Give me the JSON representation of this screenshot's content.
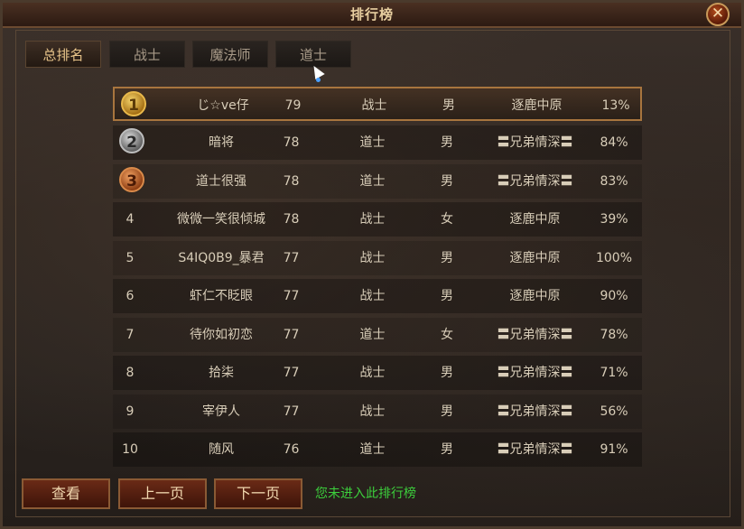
{
  "window": {
    "title": "排行榜",
    "close_label": "✕"
  },
  "tabs": [
    {
      "label": "总排名",
      "active": true
    },
    {
      "label": "战士",
      "active": false
    },
    {
      "label": "魔法师",
      "active": false
    },
    {
      "label": "道士",
      "active": false
    }
  ],
  "rows": [
    {
      "rank": "1",
      "name": "じ☆ve仔",
      "level": "79",
      "class": "战士",
      "gender": "男",
      "guild": "逐鹿中原",
      "pct": "13%"
    },
    {
      "rank": "2",
      "name": "暗将",
      "level": "78",
      "class": "道士",
      "gender": "男",
      "guild": "〓兄弟情深〓",
      "pct": "84%"
    },
    {
      "rank": "3",
      "name": "道士很强",
      "level": "78",
      "class": "道士",
      "gender": "男",
      "guild": "〓兄弟情深〓",
      "pct": "83%"
    },
    {
      "rank": "4",
      "name": "微微一笑很倾城",
      "level": "78",
      "class": "战士",
      "gender": "女",
      "guild": "逐鹿中原",
      "pct": "39%"
    },
    {
      "rank": "5",
      "name": "S4IQ0B9_暴君",
      "level": "77",
      "class": "战士",
      "gender": "男",
      "guild": "逐鹿中原",
      "pct": "100%"
    },
    {
      "rank": "6",
      "name": "虾仁不眨眼",
      "level": "77",
      "class": "战士",
      "gender": "男",
      "guild": "逐鹿中原",
      "pct": "90%"
    },
    {
      "rank": "7",
      "name": "待你如初恋",
      "level": "77",
      "class": "道士",
      "gender": "女",
      "guild": "〓兄弟情深〓",
      "pct": "78%"
    },
    {
      "rank": "8",
      "name": "拾柒",
      "level": "77",
      "class": "战士",
      "gender": "男",
      "guild": "〓兄弟情深〓",
      "pct": "71%"
    },
    {
      "rank": "9",
      "name": "宰伊人",
      "level": "77",
      "class": "战士",
      "gender": "男",
      "guild": "〓兄弟情深〓",
      "pct": "56%"
    },
    {
      "rank": "10",
      "name": "随风",
      "level": "76",
      "class": "道士",
      "gender": "男",
      "guild": "〓兄弟情深〓",
      "pct": "91%"
    }
  ],
  "buttons": {
    "view": "查看",
    "prev": "上一页",
    "next": "下一页"
  },
  "status": "您未进入此排行榜",
  "colors": {
    "status_green": "#3ccf3c",
    "title_gold": "#e8cfa0",
    "selected_border": "#a8753e"
  }
}
